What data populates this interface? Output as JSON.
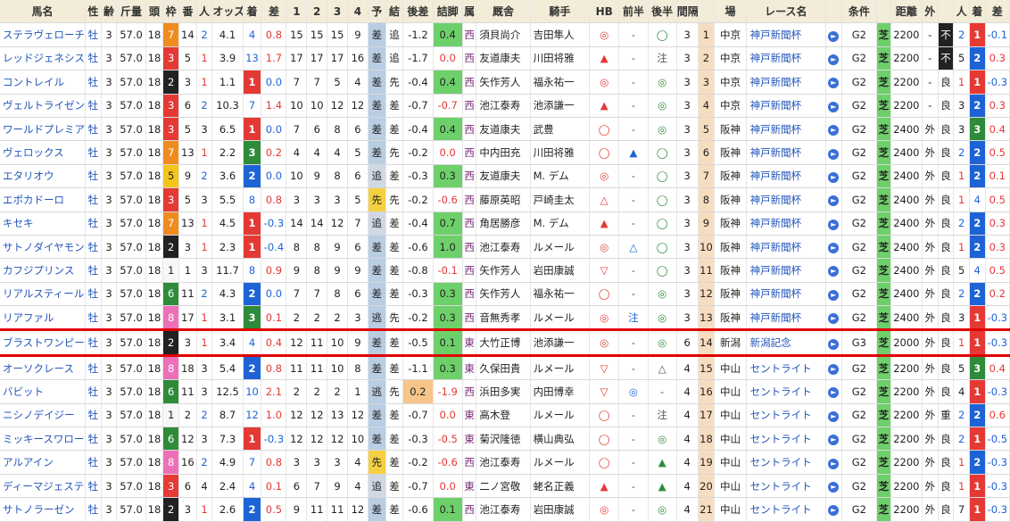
{
  "headers": [
    "馬名",
    "性",
    "齢",
    "斤量",
    "頭",
    "枠",
    "番",
    "人",
    "オッズ",
    "着",
    "差",
    "1",
    "2",
    "3",
    "4",
    "予",
    "結",
    "後差",
    "詰脚",
    "属",
    "厩舎",
    "騎手",
    "HB",
    "前半",
    "後半",
    "間隔",
    "",
    "場",
    "レース名",
    "",
    "条件",
    "",
    "距離",
    "外",
    "",
    "人",
    "着",
    "差"
  ],
  "rows": [
    {
      "name": "ステラヴェローチェ",
      "sex": "牡",
      "age": "3",
      "kin": "57.0",
      "tou": "18",
      "waku": "7",
      "ban": "14",
      "pop": "2",
      "odds": "4.1",
      "chaku": "4",
      "sa": "0.8",
      "c1": "15",
      "c2": "15",
      "c3": "15",
      "c4": "9",
      "yo": "差",
      "ketsu": "追",
      "kousa": "-1.2",
      "tsume": "0.4",
      "zoku": "西",
      "trainer": "須貝尚介",
      "jockey": "吉田隼人",
      "hb": "◎",
      "zen": "-",
      "kou": "◯",
      "kan": "3",
      "idx": "1",
      "ba": "中京",
      "race": "神戸新聞杯",
      "cls": "G2",
      "track": "芝",
      "dist": "2200",
      "soto": "-",
      "baba": "不",
      "rpop": "2",
      "rchaku": "1",
      "rsa": "-0.1"
    },
    {
      "name": "レッドジェネシス",
      "sex": "牡",
      "age": "3",
      "kin": "57.0",
      "tou": "18",
      "waku": "3",
      "ban": "5",
      "pop": "1",
      "odds": "3.9",
      "chaku": "13",
      "sa": "1.7",
      "c1": "17",
      "c2": "17",
      "c3": "17",
      "c4": "16",
      "yo": "差",
      "ketsu": "追",
      "kousa": "-1.7",
      "tsume": "0.0",
      "zoku": "西",
      "trainer": "友道康夫",
      "jockey": "川田将雅",
      "hb": "▲",
      "zen": "-",
      "kou": "注",
      "kan": "3",
      "idx": "2",
      "ba": "中京",
      "race": "神戸新聞杯",
      "cls": "G2",
      "track": "芝",
      "dist": "2200",
      "soto": "-",
      "baba": "不",
      "rpop": "5",
      "rchaku": "2",
      "rsa": "0.3"
    },
    {
      "name": "コントレイル",
      "sex": "牡",
      "age": "3",
      "kin": "57.0",
      "tou": "18",
      "waku": "2",
      "ban": "3",
      "pop": "1",
      "odds": "1.1",
      "chaku": "1",
      "sa": "0.0",
      "c1": "7",
      "c2": "7",
      "c3": "5",
      "c4": "4",
      "yo": "差",
      "ketsu": "先",
      "kousa": "-0.4",
      "tsume": "0.4",
      "zoku": "西",
      "trainer": "矢作芳人",
      "jockey": "福永祐一",
      "hb": "◎",
      "zen": "-",
      "kou": "◎",
      "kan": "3",
      "idx": "3",
      "ba": "中京",
      "race": "神戸新聞杯",
      "cls": "G2",
      "track": "芝",
      "dist": "2200",
      "soto": "-",
      "baba": "良",
      "rpop": "1",
      "rchaku": "1",
      "rsa": "-0.3"
    },
    {
      "name": "ヴェルトライゼンデ",
      "sex": "牡",
      "age": "3",
      "kin": "57.0",
      "tou": "18",
      "waku": "3",
      "ban": "6",
      "pop": "2",
      "odds": "10.3",
      "chaku": "7",
      "sa": "1.4",
      "c1": "10",
      "c2": "10",
      "c3": "12",
      "c4": "12",
      "yo": "差",
      "ketsu": "差",
      "kousa": "-0.7",
      "tsume": "-0.7",
      "zoku": "西",
      "trainer": "池江泰寿",
      "jockey": "池添謙一",
      "hb": "▲",
      "zen": "-",
      "kou": "◎",
      "kan": "3",
      "idx": "4",
      "ba": "中京",
      "race": "神戸新聞杯",
      "cls": "G2",
      "track": "芝",
      "dist": "2200",
      "soto": "-",
      "baba": "良",
      "rpop": "3",
      "rchaku": "2",
      "rsa": "0.3"
    },
    {
      "name": "ワールドプレミア",
      "sex": "牡",
      "age": "3",
      "kin": "57.0",
      "tou": "18",
      "waku": "3",
      "ban": "5",
      "pop": "3",
      "odds": "6.5",
      "chaku": "1",
      "sa": "0.0",
      "c1": "7",
      "c2": "6",
      "c3": "8",
      "c4": "6",
      "yo": "差",
      "ketsu": "差",
      "kousa": "-0.4",
      "tsume": "0.4",
      "zoku": "西",
      "trainer": "友道康夫",
      "jockey": "武豊",
      "hb": "◯",
      "zen": "-",
      "kou": "◎",
      "kan": "3",
      "idx": "5",
      "ba": "阪神",
      "race": "神戸新聞杯",
      "cls": "G2",
      "track": "芝",
      "dist": "2400",
      "soto": "外",
      "baba": "良",
      "rpop": "3",
      "rchaku": "3",
      "rsa": "0.4"
    },
    {
      "name": "ヴェロックス",
      "sex": "牡",
      "age": "3",
      "kin": "57.0",
      "tou": "18",
      "waku": "7",
      "ban": "13",
      "pop": "1",
      "odds": "2.2",
      "chaku": "3",
      "sa": "0.2",
      "c1": "4",
      "c2": "4",
      "c3": "4",
      "c4": "5",
      "yo": "差",
      "ketsu": "先",
      "kousa": "-0.2",
      "tsume": "0.0",
      "zoku": "西",
      "trainer": "中内田充",
      "jockey": "川田将雅",
      "hb": "◯",
      "zen": "▲",
      "kou": "◯",
      "kan": "3",
      "idx": "6",
      "ba": "阪神",
      "race": "神戸新聞杯",
      "cls": "G2",
      "track": "芝",
      "dist": "2400",
      "soto": "外",
      "baba": "良",
      "rpop": "2",
      "rchaku": "2",
      "rsa": "0.5"
    },
    {
      "name": "エタリオウ",
      "sex": "牡",
      "age": "3",
      "kin": "57.0",
      "tou": "18",
      "waku": "5",
      "ban": "9",
      "pop": "2",
      "odds": "3.6",
      "chaku": "2",
      "sa": "0.0",
      "c1": "10",
      "c2": "9",
      "c3": "8",
      "c4": "6",
      "yo": "追",
      "ketsu": "差",
      "kousa": "-0.3",
      "tsume": "0.3",
      "zoku": "西",
      "trainer": "友道康夫",
      "jockey": "M. デム",
      "hb": "◎",
      "zen": "-",
      "kou": "◯",
      "kan": "3",
      "idx": "7",
      "ba": "阪神",
      "race": "神戸新聞杯",
      "cls": "G2",
      "track": "芝",
      "dist": "2400",
      "soto": "外",
      "baba": "良",
      "rpop": "1",
      "rchaku": "2",
      "rsa": "0.1"
    },
    {
      "name": "エポカドーロ",
      "sex": "牡",
      "age": "3",
      "kin": "57.0",
      "tou": "18",
      "waku": "3",
      "ban": "5",
      "pop": "3",
      "odds": "5.5",
      "chaku": "8",
      "sa": "0.8",
      "c1": "3",
      "c2": "3",
      "c3": "3",
      "c4": "5",
      "yo": "先",
      "ketsu": "先",
      "kousa": "-0.2",
      "tsume": "-0.6",
      "zoku": "西",
      "trainer": "藤原英昭",
      "jockey": "戸崎圭太",
      "hb": "△",
      "zen": "-",
      "kou": "◯",
      "kan": "3",
      "idx": "8",
      "ba": "阪神",
      "race": "神戸新聞杯",
      "cls": "G2",
      "track": "芝",
      "dist": "2400",
      "soto": "外",
      "baba": "良",
      "rpop": "1",
      "rchaku": "4",
      "rsa": "0.5"
    },
    {
      "name": "キセキ",
      "sex": "牡",
      "age": "3",
      "kin": "57.0",
      "tou": "18",
      "waku": "7",
      "ban": "13",
      "pop": "1",
      "odds": "4.5",
      "chaku": "1",
      "sa": "-0.3",
      "c1": "14",
      "c2": "14",
      "c3": "12",
      "c4": "7",
      "yo": "追",
      "ketsu": "差",
      "kousa": "-0.4",
      "tsume": "0.7",
      "zoku": "西",
      "trainer": "角居勝彦",
      "jockey": "M. デム",
      "hb": "▲",
      "zen": "-",
      "kou": "◯",
      "kan": "3",
      "idx": "9",
      "ba": "阪神",
      "race": "神戸新聞杯",
      "cls": "G2",
      "track": "芝",
      "dist": "2400",
      "soto": "外",
      "baba": "良",
      "rpop": "2",
      "rchaku": "2",
      "rsa": "0.3"
    },
    {
      "name": "サトノダイヤモンド",
      "sex": "牡",
      "age": "3",
      "kin": "57.0",
      "tou": "18",
      "waku": "2",
      "ban": "3",
      "pop": "1",
      "odds": "2.3",
      "chaku": "1",
      "sa": "-0.4",
      "c1": "8",
      "c2": "8",
      "c3": "9",
      "c4": "6",
      "yo": "差",
      "ketsu": "差",
      "kousa": "-0.6",
      "tsume": "1.0",
      "zoku": "西",
      "trainer": "池江泰寿",
      "jockey": "ルメール",
      "hb": "◎",
      "zen": "△",
      "kou": "◯",
      "kan": "3",
      "idx": "10",
      "ba": "阪神",
      "race": "神戸新聞杯",
      "cls": "G2",
      "track": "芝",
      "dist": "2400",
      "soto": "外",
      "baba": "良",
      "rpop": "1",
      "rchaku": "2",
      "rsa": "0.3"
    },
    {
      "name": "カフジプリンス",
      "sex": "牡",
      "age": "3",
      "kin": "57.0",
      "tou": "18",
      "waku": "1",
      "ban": "1",
      "pop": "3",
      "odds": "11.7",
      "chaku": "8",
      "sa": "0.9",
      "c1": "9",
      "c2": "8",
      "c3": "9",
      "c4": "9",
      "yo": "差",
      "ketsu": "差",
      "kousa": "-0.8",
      "tsume": "-0.1",
      "zoku": "西",
      "trainer": "矢作芳人",
      "jockey": "岩田康誠",
      "hb": "▽",
      "zen": "-",
      "kou": "◯",
      "kan": "3",
      "idx": "11",
      "ba": "阪神",
      "race": "神戸新聞杯",
      "cls": "G2",
      "track": "芝",
      "dist": "2400",
      "soto": "外",
      "baba": "良",
      "rpop": "5",
      "rchaku": "4",
      "rsa": "0.5"
    },
    {
      "name": "リアルスティール",
      "sex": "牡",
      "age": "3",
      "kin": "57.0",
      "tou": "18",
      "waku": "6",
      "ban": "11",
      "pop": "2",
      "odds": "4.3",
      "chaku": "2",
      "sa": "0.0",
      "c1": "7",
      "c2": "7",
      "c3": "8",
      "c4": "6",
      "yo": "差",
      "ketsu": "差",
      "kousa": "-0.3",
      "tsume": "0.3",
      "zoku": "西",
      "trainer": "矢作芳人",
      "jockey": "福永祐一",
      "hb": "◯",
      "zen": "-",
      "kou": "◎",
      "kan": "3",
      "idx": "12",
      "ba": "阪神",
      "race": "神戸新聞杯",
      "cls": "G2",
      "track": "芝",
      "dist": "2400",
      "soto": "外",
      "baba": "良",
      "rpop": "2",
      "rchaku": "2",
      "rsa": "0.2"
    },
    {
      "name": "リアファル",
      "sex": "牡",
      "age": "3",
      "kin": "57.0",
      "tou": "18",
      "waku": "8",
      "ban": "17",
      "pop": "1",
      "odds": "3.1",
      "chaku": "3",
      "sa": "0.1",
      "c1": "2",
      "c2": "2",
      "c3": "2",
      "c4": "3",
      "yo": "逃",
      "ketsu": "先",
      "kousa": "-0.2",
      "tsume": "0.3",
      "zoku": "西",
      "trainer": "音無秀孝",
      "jockey": "ルメール",
      "hb": "◎",
      "zen": "注",
      "kou": "◎",
      "kan": "3",
      "idx": "13",
      "ba": "阪神",
      "race": "神戸新聞杯",
      "cls": "G2",
      "track": "芝",
      "dist": "2400",
      "soto": "外",
      "baba": "良",
      "rpop": "3",
      "rchaku": "1",
      "rsa": "-0.3"
    },
    {
      "name": "ブラストワンピース",
      "sex": "牡",
      "age": "3",
      "kin": "57.0",
      "tou": "18",
      "waku": "2",
      "ban": "3",
      "pop": "1",
      "odds": "3.4",
      "chaku": "4",
      "sa": "0.4",
      "c1": "12",
      "c2": "11",
      "c3": "10",
      "c4": "9",
      "yo": "差",
      "ketsu": "差",
      "kousa": "-0.5",
      "tsume": "0.1",
      "zoku": "東",
      "trainer": "大竹正博",
      "jockey": "池添謙一",
      "hb": "◎",
      "zen": "-",
      "kou": "◎",
      "kan": "6",
      "idx": "14",
      "ba": "新潟",
      "race": "新潟記念",
      "cls": "G3",
      "track": "芝",
      "dist": "2000",
      "soto": "外",
      "baba": "良",
      "rpop": "1",
      "rchaku": "1",
      "rsa": "-0.3"
    },
    {
      "name": "オーソクレース",
      "sex": "牡",
      "age": "3",
      "kin": "57.0",
      "tou": "18",
      "waku": "8",
      "ban": "18",
      "pop": "3",
      "odds": "5.4",
      "chaku": "2",
      "sa": "0.8",
      "c1": "11",
      "c2": "11",
      "c3": "10",
      "c4": "8",
      "yo": "差",
      "ketsu": "差",
      "kousa": "-1.1",
      "tsume": "0.3",
      "zoku": "東",
      "trainer": "久保田貴",
      "jockey": "ルメール",
      "hb": "▽",
      "zen": "-",
      "kou": "△",
      "kan": "4",
      "idx": "15",
      "ba": "中山",
      "race": "セントライト",
      "cls": "G2",
      "track": "芝",
      "dist": "2200",
      "soto": "外",
      "baba": "良",
      "rpop": "5",
      "rchaku": "3",
      "rsa": "0.4"
    },
    {
      "name": "バビット",
      "sex": "牡",
      "age": "3",
      "kin": "57.0",
      "tou": "18",
      "waku": "6",
      "ban": "11",
      "pop": "3",
      "odds": "12.5",
      "chaku": "10",
      "sa": "2.1",
      "c1": "2",
      "c2": "2",
      "c3": "2",
      "c4": "1",
      "yo": "逃",
      "ketsu": "先",
      "kousa": "0.2",
      "tsume": "-1.9",
      "zoku": "西",
      "trainer": "浜田多実",
      "jockey": "内田博幸",
      "hb": "▽",
      "zen": "◎",
      "kou": "-",
      "kan": "4",
      "idx": "16",
      "ba": "中山",
      "race": "セントライト",
      "cls": "G2",
      "track": "芝",
      "dist": "2200",
      "soto": "外",
      "baba": "良",
      "rpop": "4",
      "rchaku": "1",
      "rsa": "-0.3"
    },
    {
      "name": "ニシノデイジー",
      "sex": "牡",
      "age": "3",
      "kin": "57.0",
      "tou": "18",
      "waku": "1",
      "ban": "2",
      "pop": "2",
      "odds": "8.7",
      "chaku": "12",
      "sa": "1.0",
      "c1": "12",
      "c2": "12",
      "c3": "13",
      "c4": "12",
      "yo": "差",
      "ketsu": "差",
      "kousa": "-0.7",
      "tsume": "0.0",
      "zoku": "東",
      "trainer": "高木登",
      "jockey": "ルメール",
      "hb": "◯",
      "zen": "-",
      "kou": "注",
      "kan": "4",
      "idx": "17",
      "ba": "中山",
      "race": "セントライト",
      "cls": "G2",
      "track": "芝",
      "dist": "2200",
      "soto": "外",
      "baba": "重",
      "rpop": "2",
      "rchaku": "2",
      "rsa": "0.6"
    },
    {
      "name": "ミッキースワロー",
      "sex": "牡",
      "age": "3",
      "kin": "57.0",
      "tou": "18",
      "waku": "6",
      "ban": "12",
      "pop": "3",
      "odds": "7.3",
      "chaku": "1",
      "sa": "-0.3",
      "c1": "12",
      "c2": "12",
      "c3": "12",
      "c4": "10",
      "yo": "差",
      "ketsu": "差",
      "kousa": "-0.3",
      "tsume": "-0.5",
      "zoku": "東",
      "trainer": "菊沢隆徳",
      "jockey": "横山典弘",
      "hb": "◯",
      "zen": "-",
      "kou": "◎",
      "kan": "4",
      "idx": "18",
      "ba": "中山",
      "race": "セントライト",
      "cls": "G2",
      "track": "芝",
      "dist": "2200",
      "soto": "外",
      "baba": "良",
      "rpop": "2",
      "rchaku": "1",
      "rsa": "-0.5"
    },
    {
      "name": "アルアイン",
      "sex": "牡",
      "age": "3",
      "kin": "57.0",
      "tou": "18",
      "waku": "8",
      "ban": "16",
      "pop": "2",
      "odds": "4.9",
      "chaku": "7",
      "sa": "0.8",
      "c1": "3",
      "c2": "3",
      "c3": "3",
      "c4": "4",
      "yo": "先",
      "ketsu": "差",
      "kousa": "-0.2",
      "tsume": "-0.6",
      "zoku": "西",
      "trainer": "池江泰寿",
      "jockey": "ルメール",
      "hb": "◯",
      "zen": "-",
      "kou": "▲",
      "kan": "4",
      "idx": "19",
      "ba": "中山",
      "race": "セントライト",
      "cls": "G2",
      "track": "芝",
      "dist": "2200",
      "soto": "外",
      "baba": "良",
      "rpop": "1",
      "rchaku": "2",
      "rsa": "-0.3"
    },
    {
      "name": "ディーマジェスティ",
      "sex": "牡",
      "age": "3",
      "kin": "57.0",
      "tou": "18",
      "waku": "3",
      "ban": "6",
      "pop": "4",
      "odds": "2.4",
      "chaku": "4",
      "sa": "0.1",
      "c1": "6",
      "c2": "7",
      "c3": "9",
      "c4": "4",
      "yo": "追",
      "ketsu": "差",
      "kousa": "-0.7",
      "tsume": "0.0",
      "zoku": "東",
      "trainer": "二ノ宮敬",
      "jockey": "蛯名正義",
      "hb": "▲",
      "zen": "-",
      "kou": "▲",
      "kan": "4",
      "idx": "20",
      "ba": "中山",
      "race": "セントライト",
      "cls": "G2",
      "track": "芝",
      "dist": "2200",
      "soto": "外",
      "baba": "良",
      "rpop": "1",
      "rchaku": "1",
      "rsa": "-0.3"
    },
    {
      "name": "サトノラーゼン",
      "sex": "牡",
      "age": "3",
      "kin": "57.0",
      "tou": "18",
      "waku": "2",
      "ban": "3",
      "pop": "1",
      "odds": "2.6",
      "chaku": "2",
      "sa": "0.5",
      "c1": "9",
      "c2": "11",
      "c3": "11",
      "c4": "12",
      "yo": "差",
      "ketsu": "差",
      "kousa": "-0.6",
      "tsume": "0.1",
      "zoku": "西",
      "trainer": "池江泰寿",
      "jockey": "岩田康誠",
      "hb": "◎",
      "zen": "-",
      "kou": "◎",
      "kan": "4",
      "idx": "21",
      "ba": "中山",
      "race": "セントライト",
      "cls": "G2",
      "track": "芝",
      "dist": "2200",
      "soto": "外",
      "baba": "良",
      "rpop": "7",
      "rchaku": "1",
      "rsa": "-0.3"
    }
  ]
}
